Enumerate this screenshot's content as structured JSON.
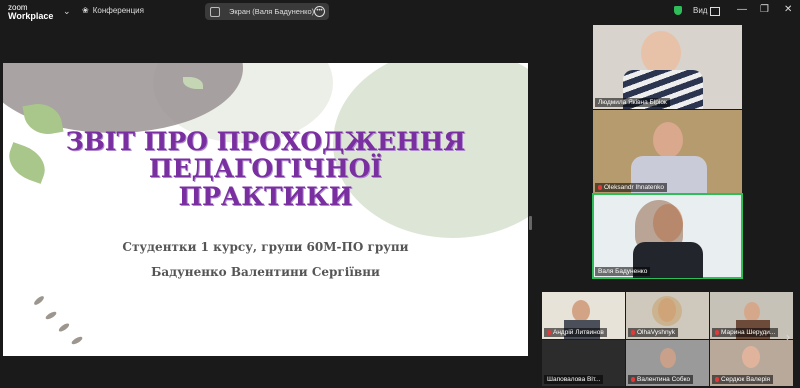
{
  "app": {
    "logo_line1": "zoom",
    "logo_line2": "Workplace"
  },
  "topbar": {
    "meeting_label": "Конференция",
    "share_label": "Экран (Валя Бадуненко)",
    "more_glyph": "•••",
    "view_label": "Вид"
  },
  "slide": {
    "title_line1": "ЗВІТ ПРО ПРОХОДЖЕННЯ",
    "title_line2": "ПЕДАГОГІЧНОЇ",
    "title_line3": "ПРАКТИКИ",
    "subtitle_line1": "Студентки 1 курсу, групи 60М-ПО групи",
    "subtitle_line2": "Бадуненко Валентини Сергіївни"
  },
  "participants": [
    {
      "name": "Людмила Яківна Біріок"
    },
    {
      "name": "Oleksandr Ihnatenko"
    },
    {
      "name": "Валя Бадуненко"
    },
    {
      "name": "Андрій Литвинов"
    },
    {
      "name": "OlhaVyshnyk"
    },
    {
      "name": "Марина Шеруди..."
    },
    {
      "name": "Шаповалова Віт..."
    },
    {
      "name": "Валентина Собко"
    },
    {
      "name": "Сердюк Валерія"
    }
  ],
  "colors": {
    "active_border": "#2ebd59",
    "title_purple": "#7a2fa0",
    "muted_red": "#e03a3a"
  }
}
